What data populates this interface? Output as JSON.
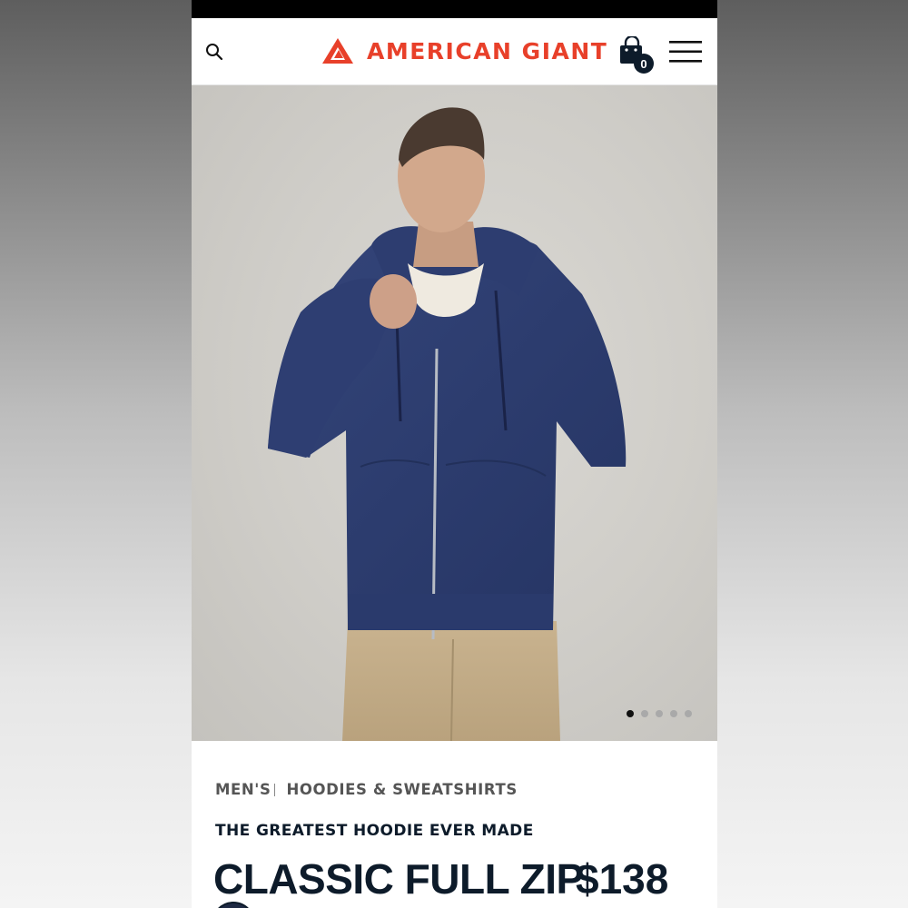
{
  "header": {
    "brand_name": "AMERICAN GIANT",
    "brand_color": "#e8402a",
    "search_icon": "search-icon",
    "cart_icon": "shopping-bag-icon",
    "cart_count": "0",
    "menu_icon": "hamburger-menu-icon"
  },
  "gallery": {
    "image_count": 5,
    "active_index": 0
  },
  "product": {
    "breadcrumb": [
      "MEN'S",
      "HOODIES & SWEATSHIRTS"
    ],
    "tagline": "THE GREATEST HOODIE EVER MADE",
    "title": "CLASSIC FULL ZIP",
    "price": "$138",
    "swatch_color": "#1f2a44"
  },
  "colors": {
    "navy_text": "#0d1b2a",
    "accent": "#e8402a"
  }
}
